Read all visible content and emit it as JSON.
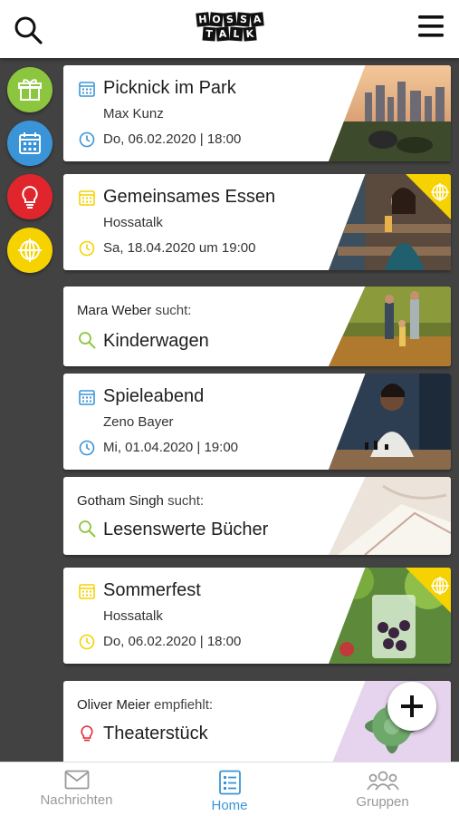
{
  "header": {
    "logo_text_line1": "HOSSA",
    "logo_text_line2": "TALK",
    "logo_letters_row1": [
      "H",
      "O",
      "S",
      "S",
      "A"
    ],
    "logo_letters_row2": [
      "T",
      "A",
      "L",
      "K"
    ]
  },
  "side_rail": {
    "items": [
      {
        "icon": "gift-icon",
        "color": "#8cc63f"
      },
      {
        "icon": "calendar-icon",
        "color": "#3a95d8"
      },
      {
        "icon": "lightbulb-icon",
        "color": "#e0252d"
      },
      {
        "icon": "globe-icon",
        "color": "#f6d200"
      }
    ]
  },
  "cards": [
    {
      "type": "event",
      "title": "Picknick im Park",
      "organizer": "Max Kunz",
      "date": "Do, 06.02.2020 | 18:00",
      "accent": "#3a95d8",
      "photo": "city-park-skyline"
    },
    {
      "type": "event",
      "title": "Gemeinsames Essen",
      "organizer": "Hossatalk",
      "date": "Sa, 18.04.2020 um 19:00",
      "accent": "#f6d200",
      "photo": "woman-laughing-drink",
      "badge": "globe-icon"
    },
    {
      "type": "search",
      "name": "Mara Weber",
      "verb": "sucht:",
      "title": "Kinderwagen",
      "accent": "#8cc63f",
      "photo": "family-walk-park"
    },
    {
      "type": "event",
      "title": "Spieleabend",
      "organizer": "Zeno Bayer",
      "date": "Mi, 01.04.2020 | 19:00",
      "accent": "#3a95d8",
      "photo": "chess-players"
    },
    {
      "type": "search",
      "name": "Gotham Singh",
      "verb": "sucht:",
      "title": "Lesenswerte Bücher",
      "accent": "#8cc63f",
      "photo": "open-book"
    },
    {
      "type": "event",
      "title": "Sommerfest",
      "organizer": "Hossatalk",
      "date": "Do, 06.02.2020 | 18:00",
      "accent": "#f6d200",
      "photo": "berry-drink",
      "badge": "globe-icon"
    },
    {
      "type": "recommend",
      "name": "Oliver Meier",
      "verb": "empfiehlt:",
      "title": "Theaterstück",
      "accent": "#e0252d",
      "photo": "succulent-plant"
    }
  ],
  "fab": {
    "icon": "plus-icon"
  },
  "bottom_nav": {
    "items": [
      {
        "label": "Nachrichten",
        "icon": "envelope-icon",
        "active": false
      },
      {
        "label": "Home",
        "icon": "list-icon",
        "active": true
      },
      {
        "label": "Gruppen",
        "icon": "group-icon",
        "active": false
      }
    ]
  },
  "colors": {
    "accent_blue": "#3a95d8",
    "accent_yellow": "#f6d200",
    "accent_green": "#8cc63f",
    "accent_red": "#e0252d",
    "background": "#424242"
  }
}
